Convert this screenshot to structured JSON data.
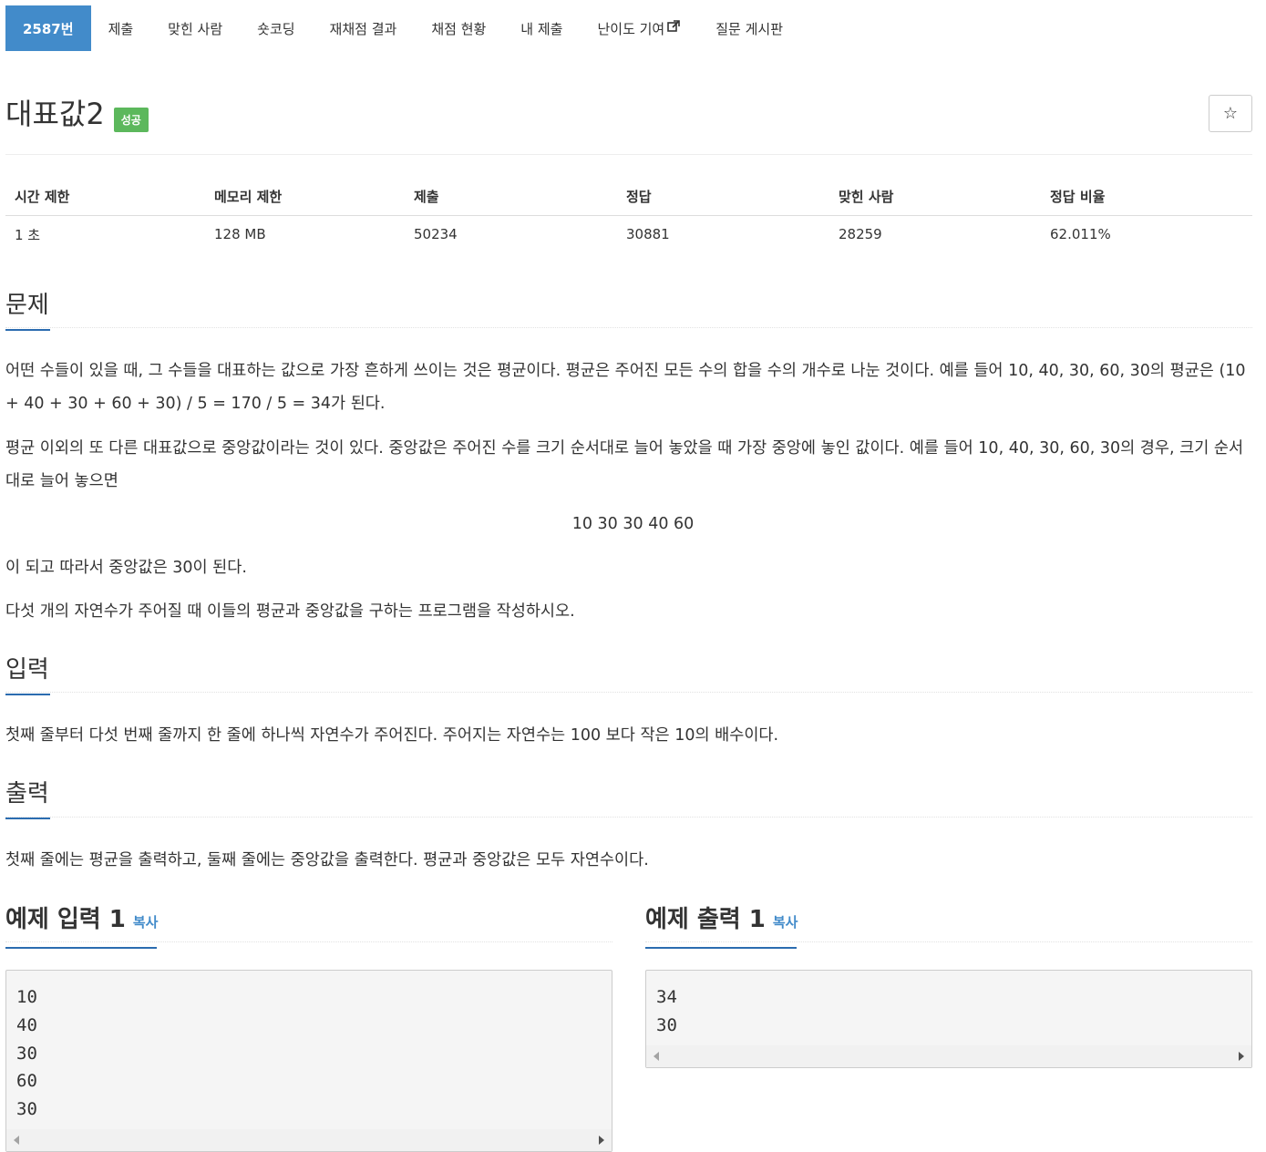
{
  "tabs": [
    {
      "label": "2587번",
      "active": true
    },
    {
      "label": "제출"
    },
    {
      "label": "맞힌 사람"
    },
    {
      "label": "숏코딩"
    },
    {
      "label": "재채점 결과"
    },
    {
      "label": "채점 현황"
    },
    {
      "label": "내 제출"
    },
    {
      "label": "난이도 기여",
      "icon": "external-link-icon"
    },
    {
      "label": "질문 게시판"
    }
  ],
  "problem": {
    "title": "대표값2",
    "badge": "성공",
    "star": "☆"
  },
  "info_table": {
    "headers": [
      "시간 제한",
      "메모리 제한",
      "제출",
      "정답",
      "맞힌 사람",
      "정답 비율"
    ],
    "values": [
      "1 초",
      "128 MB",
      "50234",
      "30881",
      "28259",
      "62.011%"
    ]
  },
  "sections": {
    "problem_title": "문제",
    "problem_p1": "어떤 수들이 있을 때, 그 수들을 대표하는 값으로 가장 흔하게 쓰이는 것은 평균이다. 평균은 주어진 모든 수의 합을 수의 개수로 나눈 것이다. 예를 들어 10, 40, 30, 60, 30의 평균은 (10 + 40 + 30 + 60 + 30) / 5 = 170 / 5 = 34가 된다.",
    "problem_p2": "평균 이외의 또 다른 대표값으로 중앙값이라는 것이 있다. 중앙값은 주어진 수를 크기 순서대로 늘어 놓았을 때 가장 중앙에 놓인 값이다. 예를 들어 10, 40, 30, 60, 30의 경우, 크기 순서대로 늘어 놓으면",
    "problem_center": "10 30 30 40 60",
    "problem_p3": "이 되고 따라서 중앙값은 30이 된다.",
    "problem_p4": "다섯 개의 자연수가 주어질 때 이들의 평균과 중앙값을 구하는 프로그램을 작성하시오.",
    "input_title": "입력",
    "input_text": "첫째 줄부터 다섯 번째 줄까지 한 줄에 하나씩 자연수가 주어진다. 주어지는 자연수는 100 보다 작은 10의 배수이다.",
    "output_title": "출력",
    "output_text": "첫째 줄에는 평균을 출력하고, 둘째 줄에는 중앙값을 출력한다. 평균과 중앙값은 모두 자연수이다."
  },
  "samples": {
    "input_title": "예제 입력 1",
    "output_title": "예제 출력 1",
    "copy_label": "복사",
    "input_lines": [
      "10",
      "40",
      "30",
      "60",
      "30"
    ],
    "output_lines": [
      "34",
      "30"
    ]
  },
  "colors": {
    "accent": "#428bca",
    "success": "#5cb85c",
    "underline": "#2b6cb0"
  }
}
